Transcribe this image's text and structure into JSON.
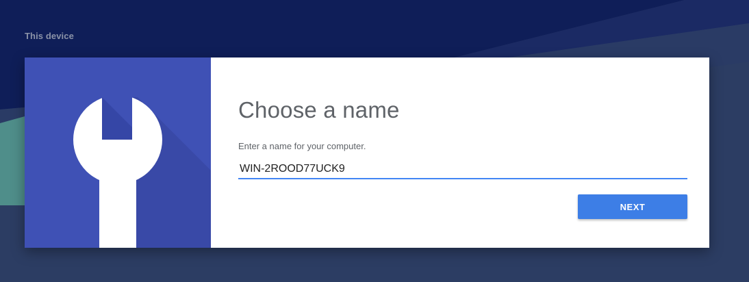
{
  "header": {
    "section_label": "This device"
  },
  "card": {
    "hero_icon": "wrench-icon",
    "title": "Choose a name",
    "subtitle": "Enter a name for your computer.",
    "name_input": {
      "value": "WIN-2ROOD77UCK9"
    },
    "next_label": "NEXT"
  },
  "colors": {
    "accent": "#3d7ee6",
    "hero_bg": "#3f51b5",
    "input_underline": "#4285f4"
  }
}
